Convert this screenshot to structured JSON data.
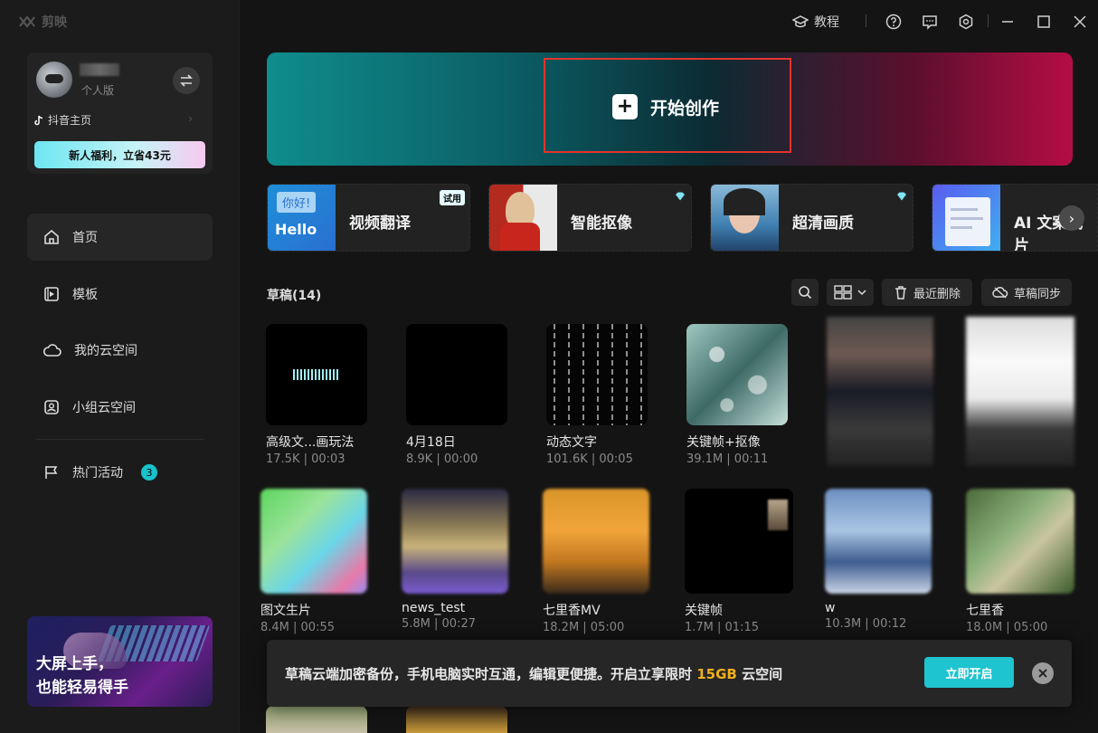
{
  "app": {
    "logo_text": "剪映"
  },
  "titlebar": {
    "tutorial_label": "教程"
  },
  "user": {
    "plan": "个人版",
    "douyin_label": "抖音主页",
    "promo_label": "新人福利，立省43元"
  },
  "nav": [
    {
      "label": "首页"
    },
    {
      "label": "模板"
    },
    {
      "label": "我的云空间"
    },
    {
      "label": "小组云空间"
    },
    {
      "label": "热门活动",
      "badge": "3"
    }
  ],
  "sidebar_banner": {
    "line1": "大屏上手，",
    "line2": "也能轻易得手"
  },
  "hero": {
    "label": "开始创作"
  },
  "features": [
    {
      "label": "视频翻译",
      "tag": "试用",
      "thumb_text1": "你好!",
      "thumb_text2": "Hello"
    },
    {
      "label": "智能抠像",
      "badge": "diamond"
    },
    {
      "label": "超清画质",
      "badge": "diamond"
    },
    {
      "label": "AI 文案成片"
    }
  ],
  "drafts": {
    "title": "草稿(14)",
    "recent_delete_label": "最近删除",
    "sync_label": "草稿同步",
    "items": [
      {
        "name": "高级文...画玩法",
        "meta": "17.5K | 00:03"
      },
      {
        "name": "4月18日",
        "meta": "8.9K | 00:00"
      },
      {
        "name": "动态文字",
        "meta": "101.6K | 00:05"
      },
      {
        "name": "关键帧+抠像",
        "meta": "39.1M | 00:11"
      },
      {
        "name": "",
        "meta": ""
      },
      {
        "name": "",
        "meta": ""
      },
      {
        "name": "图文生片",
        "meta": "8.4M | 00:55"
      },
      {
        "name": "news_test",
        "meta": "5.8M | 00:27"
      },
      {
        "name": "七里香MV",
        "meta": "18.2M | 05:00"
      },
      {
        "name": "关键帧",
        "meta": "1.7M | 01:15"
      },
      {
        "name": "w",
        "meta": "10.3M | 00:12"
      },
      {
        "name": "七里香",
        "meta": "18.0M | 05:00"
      }
    ]
  },
  "cloud_tip": {
    "text_before": "草稿云端加密备份，手机电脑实时互通，编辑更便捷。开启立享限时 ",
    "highlight": "15GB",
    "text_after": " 云空间",
    "button_label": "立即开启"
  },
  "colors": {
    "accent": "#1ec4cf",
    "highlight": "#f2b01e",
    "hero_outline": "#e1352b"
  }
}
